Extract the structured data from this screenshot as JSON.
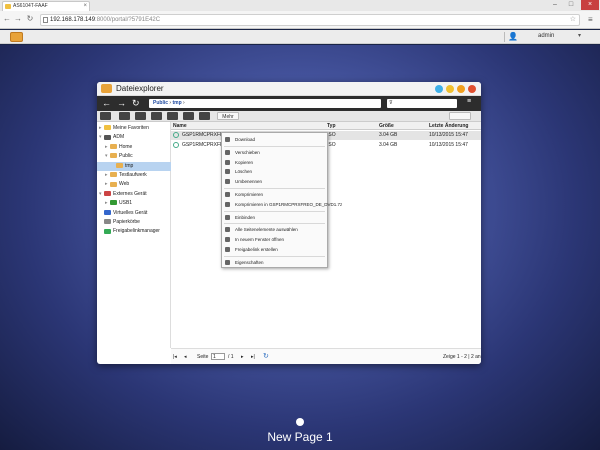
{
  "browser": {
    "tab_title": "AS6104T-FAAF",
    "tab_close": "×",
    "minimize": "–",
    "maximize": "□",
    "close": "×",
    "back": "←",
    "forward": "→",
    "reload": "↻",
    "url_host": "192.168.178.149",
    "url_path": ":8000/portal/?5791E42C",
    "star": "☆",
    "menu": "≡"
  },
  "nas": {
    "user_icon": "👤",
    "username": "admin",
    "dropdown": "▾"
  },
  "explorer": {
    "title": "Dateiexplorer",
    "breadcrumb": [
      "Public",
      "tmp"
    ],
    "breadcrumb_sep": "›",
    "filter_icon": "⊽",
    "more_label": "Mehr",
    "tree": [
      {
        "label": "Meine Favoriten",
        "indent": 0,
        "color": "#f0c040",
        "expander": "▸"
      },
      {
        "label": "ADM",
        "indent": 0,
        "color": "#555555",
        "expander": "▾"
      },
      {
        "label": "Home",
        "indent": 1,
        "color": "#e8b050",
        "expander": "▸"
      },
      {
        "label": "Public",
        "indent": 1,
        "color": "#e8b050",
        "expander": "▾"
      },
      {
        "label": "tmp",
        "indent": 2,
        "color": "#e8b050",
        "expander": "",
        "selected": true
      },
      {
        "label": "Testlaufwerk",
        "indent": 1,
        "color": "#e8b050",
        "expander": "▸"
      },
      {
        "label": "Web",
        "indent": 1,
        "color": "#e8b050",
        "expander": "▸"
      },
      {
        "label": "Externes Gerät",
        "indent": 0,
        "color": "#cc4444",
        "expander": "▾"
      },
      {
        "label": "USB1",
        "indent": 1,
        "color": "#339933",
        "expander": "▸"
      },
      {
        "label": "Virtuelles Gerät",
        "indent": 0,
        "color": "#3366cc",
        "expander": ""
      },
      {
        "label": "Papierkörbe",
        "indent": 0,
        "color": "#888888",
        "expander": ""
      },
      {
        "label": "Freigabelinkmanager",
        "indent": 0,
        "color": "#33aa55",
        "expander": ""
      }
    ],
    "columns": [
      "Name",
      "Typ",
      "Größe",
      "Letzte Änderung"
    ],
    "rows": [
      {
        "name": "GSP1RMCPRXFRE",
        "type": "ISO",
        "size": "3.04 GB",
        "modified": "10/13/2015 15:47"
      },
      {
        "name": "GSP1RMCPRXFRE",
        "type": "ISO",
        "size": "3.04 GB",
        "modified": "10/13/2015 15:47"
      }
    ],
    "status": {
      "first": "|◂",
      "prev": "◂",
      "page_label": "Seite",
      "page_value": "1",
      "page_total": "/ 1",
      "next": "▸",
      "last": "▸|",
      "summary": "Zeige 1 - 2 | 2 an"
    }
  },
  "context_menu": [
    {
      "label": "Download",
      "type": "item"
    },
    {
      "type": "sep"
    },
    {
      "label": "Verschieben",
      "type": "item"
    },
    {
      "label": "Kopieren",
      "type": "item"
    },
    {
      "label": "Löschen",
      "type": "item"
    },
    {
      "label": "Umbenennen",
      "type": "item"
    },
    {
      "type": "sep"
    },
    {
      "label": "Komprimieren",
      "type": "item"
    },
    {
      "label": "Komprimieren in GSP1RMCPRXFREO_DE_DVD1.7z",
      "type": "item"
    },
    {
      "type": "sep"
    },
    {
      "label": "Einbinden",
      "type": "item"
    },
    {
      "type": "sep"
    },
    {
      "label": "Alle Seitenelemente auswählen",
      "type": "item"
    },
    {
      "label": "In neuem Fenster öffnen",
      "type": "item"
    },
    {
      "label": "Freigabelink erstellen",
      "type": "item"
    },
    {
      "type": "sep"
    },
    {
      "label": "Eigenschaften",
      "type": "item"
    }
  ],
  "desktop": {
    "page_label": "New Page 1"
  },
  "colors": {
    "accent": "#1f4aa0",
    "window_dot_1": "#3fb0e8",
    "window_dot_2": "#f0c030",
    "window_dot_3": "#f0a020",
    "window_dot_4": "#e05030"
  }
}
